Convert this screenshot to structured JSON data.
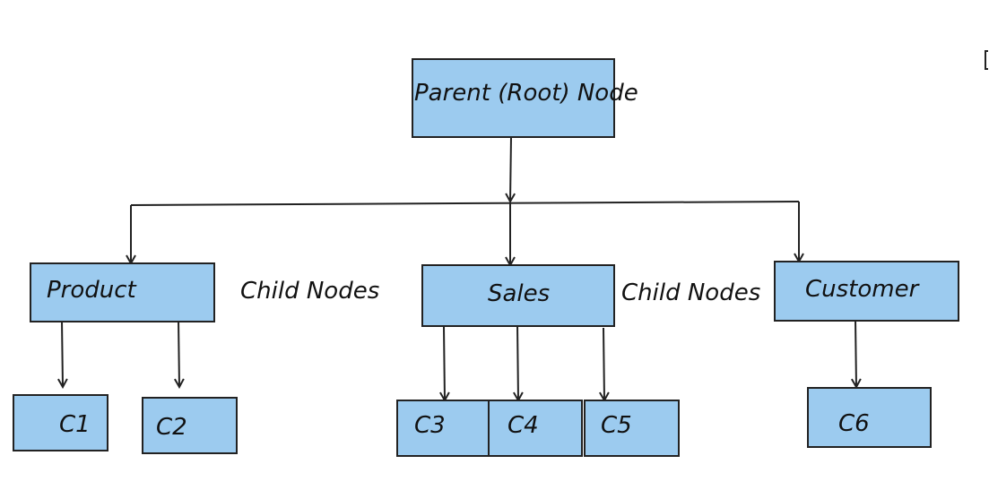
{
  "diagram": {
    "type": "tree",
    "fill_color": "#9ccbef",
    "stroke_color": "#222222",
    "root": {
      "id": "root",
      "label": "Parent (Root) Node"
    },
    "nodes": [
      {
        "id": "product",
        "label": "Product",
        "parent": "root"
      },
      {
        "id": "sales",
        "label": "Sales",
        "parent": "root"
      },
      {
        "id": "customer",
        "label": "Customer",
        "parent": "root"
      },
      {
        "id": "c1",
        "label": "C1",
        "parent": "product"
      },
      {
        "id": "c2",
        "label": "C2",
        "parent": "product"
      },
      {
        "id": "c3",
        "label": "C3",
        "parent": "sales"
      },
      {
        "id": "c4",
        "label": "C4",
        "parent": "sales"
      },
      {
        "id": "c5",
        "label": "C5",
        "parent": "sales"
      },
      {
        "id": "c6",
        "label": "C6",
        "parent": "customer"
      }
    ],
    "annotations": [
      {
        "id": "child-nodes-1",
        "label": "Child Nodes"
      },
      {
        "id": "child-nodes-2",
        "label": "Child Nodes"
      }
    ]
  }
}
